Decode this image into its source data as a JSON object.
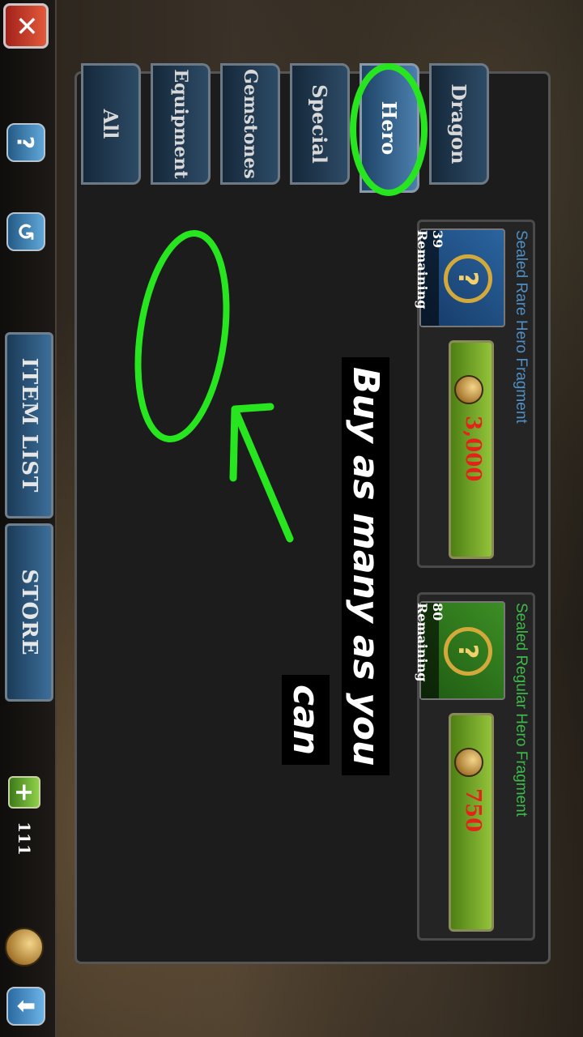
{
  "tabs": {
    "all": "All",
    "equipment": "Equipment",
    "gemstones": "Gemstones",
    "special": "Special",
    "hero": "Hero",
    "dragon": "Dragon"
  },
  "nav": {
    "store": "STORE",
    "item_list": "ITEM LIST",
    "help": "?",
    "close": "✕",
    "history": "↺",
    "down": "⬇",
    "plus": "+"
  },
  "currency": {
    "amount": "111"
  },
  "items": [
    {
      "title": "Sealed Regular Hero Fragment",
      "price": "750",
      "remaining": "80 Remaining",
      "title_color": "#3fb84a",
      "bg_color": "#2f7a1b"
    },
    {
      "title": "Sealed Rare Hero Fragment",
      "price": "3,000",
      "remaining": "39 Remaining",
      "title_color": "#4f8fc4",
      "bg_color": "#1f4f86"
    }
  ],
  "annotation": {
    "line1": "Buy as many as you",
    "line2": "can",
    "highlight_color": "#27e61f"
  }
}
